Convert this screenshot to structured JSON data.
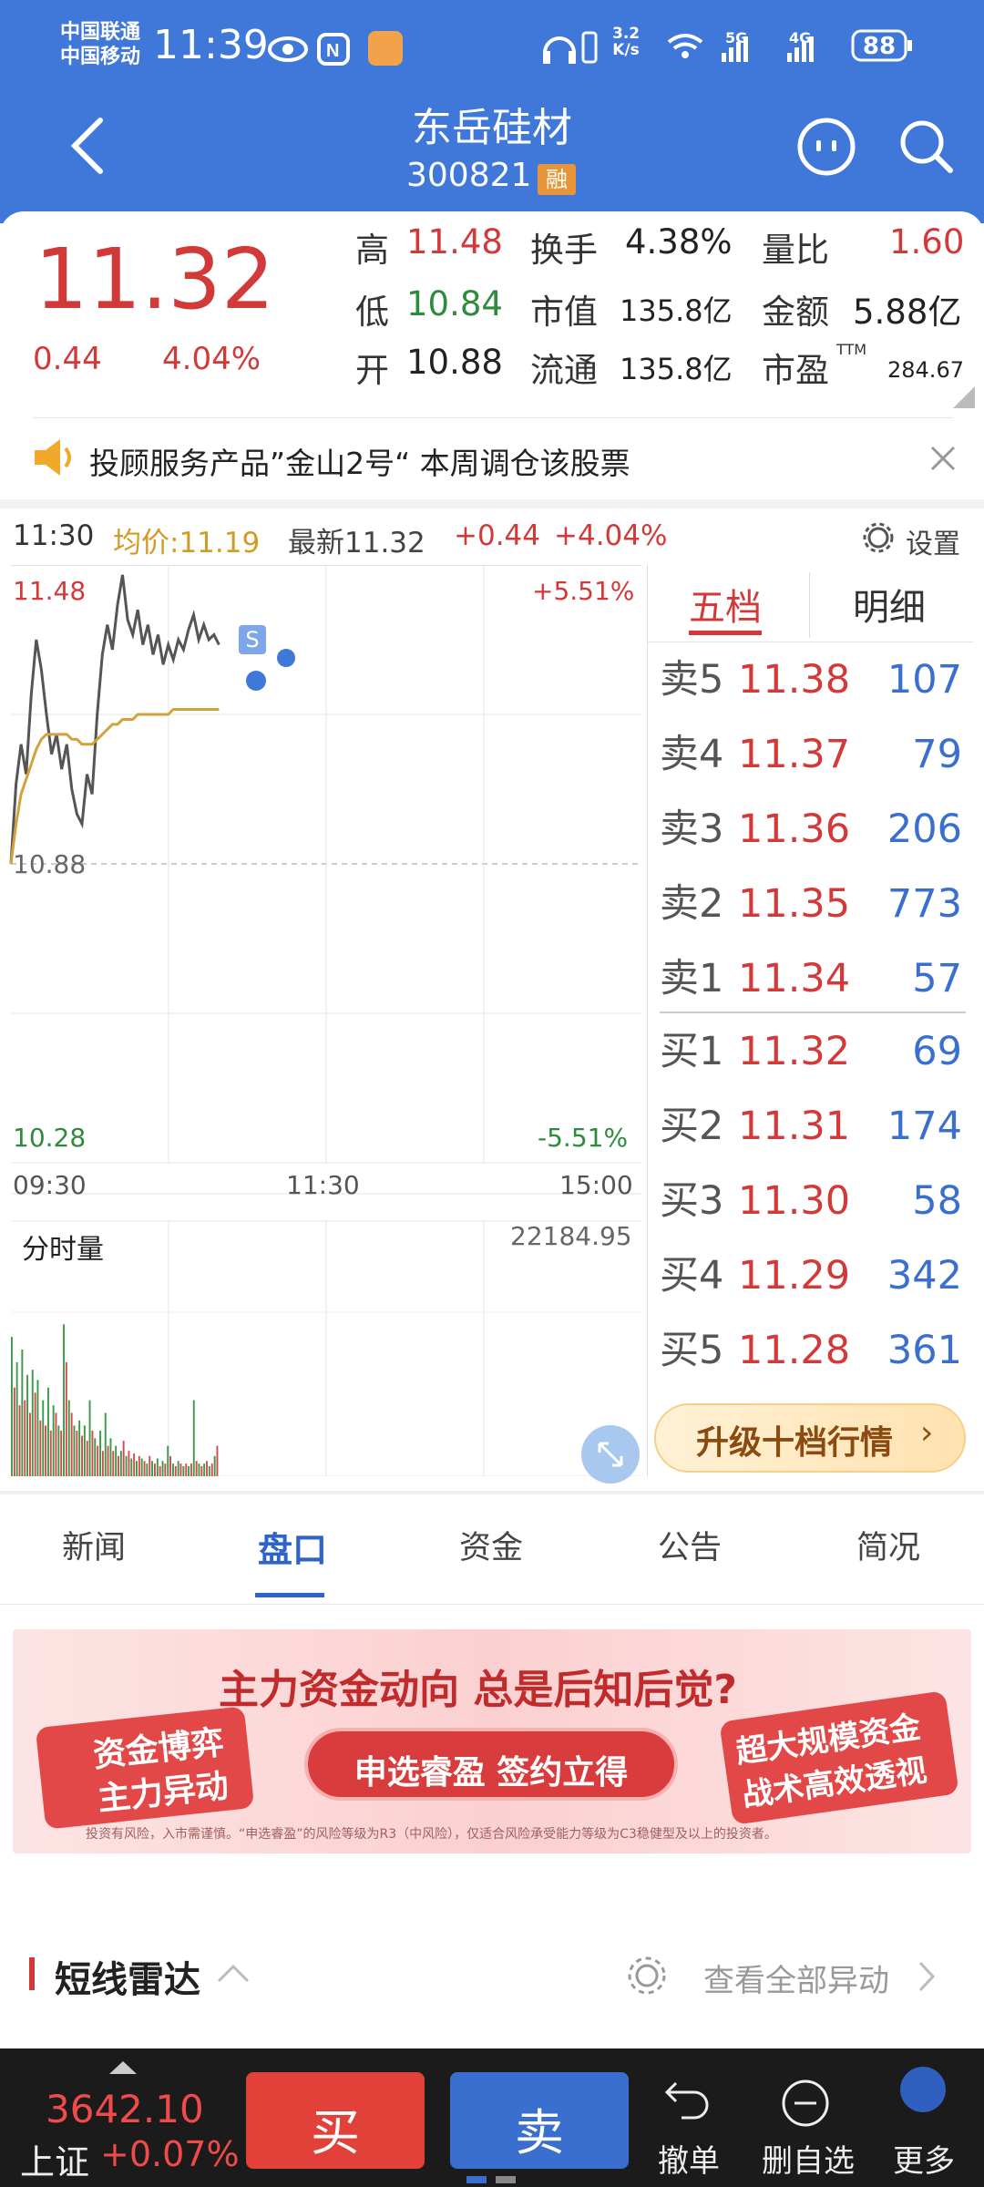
{
  "status_bar": {
    "carrier1": "中国联通",
    "carrier2": "中国移动",
    "time": "11:39",
    "net_speed_top": "3.2",
    "net_speed_bottom": "K/s",
    "battery": "88"
  },
  "header": {
    "name": "东岳硅材",
    "code": "300821",
    "badge": "融"
  },
  "quote": {
    "price": "11.32",
    "change": "0.44",
    "change_pct": "4.04%",
    "high_label": "高",
    "high": "11.48",
    "low_label": "低",
    "low": "10.84",
    "open_label": "开",
    "open": "10.88",
    "turnover_label": "换手",
    "turnover": "4.38%",
    "mcap_label": "市值",
    "mcap": "135.8亿",
    "float_label": "流通",
    "float": "135.8亿",
    "vol_ratio_label": "量比",
    "vol_ratio": "1.60",
    "amount_label": "金额",
    "amount": "5.88亿",
    "pe_label": "市盈",
    "pe_sup": "TTM",
    "pe": "284.67"
  },
  "notice": {
    "text": "投顾服务产品”金山2号“ 本周调仓该股票"
  },
  "chart_header": {
    "time": "11:30",
    "avg": "均价:11.19",
    "latest": "最新11.32",
    "chg": "+0.44",
    "chg_pct": "+4.04%",
    "settings": "设置"
  },
  "chart_labels": {
    "top_price": "11.48",
    "top_pct": "+5.51%",
    "mid_price": "10.88",
    "bot_price": "10.28",
    "bot_pct": "-5.51%",
    "t0": "09:30",
    "t1": "11:30",
    "t2": "15:00",
    "vol_title": "分时量",
    "vol_max": "22184.95",
    "marker": "S"
  },
  "chart_data": {
    "type": "line",
    "title": "",
    "ylim": [
      10.28,
      11.48
    ],
    "x_ticks": [
      "09:30",
      "11:30",
      "15:00"
    ],
    "series": [
      {
        "name": "",
        "values": [
          10.88,
          11.04,
          11.12,
          11.06,
          11.22,
          11.33,
          11.27,
          11.18,
          11.1,
          11.14,
          11.07,
          11.12,
          11.03,
          10.98,
          10.96,
          11.06,
          11.02,
          11.18,
          11.3,
          11.36,
          11.31,
          11.4,
          11.46,
          11.37,
          11.34,
          11.39,
          11.32,
          11.36,
          11.3,
          11.34,
          11.28,
          11.32,
          11.29,
          11.33,
          11.31,
          11.35,
          11.38,
          11.33,
          11.36,
          11.33,
          11.34,
          11.32
        ]
      },
      {
        "name": "",
        "values": [
          10.88,
          10.96,
          11.02,
          11.05,
          11.08,
          11.11,
          11.13,
          11.14,
          11.14,
          11.14,
          11.14,
          11.14,
          11.13,
          11.13,
          11.12,
          11.12,
          11.12,
          11.13,
          11.14,
          11.15,
          11.16,
          11.16,
          11.17,
          11.17,
          11.17,
          11.18,
          11.18,
          11.18,
          11.18,
          11.18,
          11.18,
          11.18,
          11.19,
          11.19,
          11.19,
          11.19,
          11.19,
          11.19,
          11.19,
          11.19,
          11.19,
          11.19
        ]
      }
    ],
    "volume_max": 22184.95,
    "volume": [
      0.55,
      0.35,
      0.45,
      0.28,
      0.5,
      0.3,
      0.4,
      0.25,
      0.42,
      0.33,
      0.38,
      0.22,
      0.3,
      0.2,
      0.35,
      0.18,
      0.28,
      0.25,
      0.2,
      0.18,
      0.6,
      0.45,
      0.3,
      0.25,
      0.2,
      0.18,
      0.22,
      0.16,
      0.2,
      0.14,
      0.3,
      0.18,
      0.15,
      0.12,
      0.18,
      0.1,
      0.25,
      0.12,
      0.15,
      0.1,
      0.12,
      0.08,
      0.1,
      0.14,
      0.08,
      0.1,
      0.07,
      0.09,
      0.06,
      0.08,
      0.07,
      0.06,
      0.05,
      0.08,
      0.06,
      0.05,
      0.07,
      0.04,
      0.06,
      0.05,
      0.12,
      0.08,
      0.05,
      0.04,
      0.06,
      0.05,
      0.04,
      0.05,
      0.04,
      0.05,
      0.3,
      0.06,
      0.05,
      0.04,
      0.05,
      0.06,
      0.04,
      0.05,
      0.08,
      0.12
    ]
  },
  "order_book": {
    "tab_active": "五档",
    "tab_other": "明细",
    "asks": [
      {
        "label": "卖5",
        "price": "11.38",
        "vol": "107"
      },
      {
        "label": "卖4",
        "price": "11.37",
        "vol": "79"
      },
      {
        "label": "卖3",
        "price": "11.36",
        "vol": "206"
      },
      {
        "label": "卖2",
        "price": "11.35",
        "vol": "773"
      },
      {
        "label": "卖1",
        "price": "11.34",
        "vol": "57"
      }
    ],
    "bids": [
      {
        "label": "买1",
        "price": "11.32",
        "vol": "69"
      },
      {
        "label": "买2",
        "price": "11.31",
        "vol": "174"
      },
      {
        "label": "买3",
        "price": "11.30",
        "vol": "58"
      },
      {
        "label": "买4",
        "price": "11.29",
        "vol": "342"
      },
      {
        "label": "买5",
        "price": "11.28",
        "vol": "361"
      }
    ],
    "upgrade": "升级十档行情"
  },
  "tabs": [
    "新闻",
    "盘口",
    "资金",
    "公告",
    "简况"
  ],
  "banner": {
    "headline": "主力资金动向 总是后知后觉?",
    "left1": "资金博弈",
    "left2": "主力异动",
    "cta": "申选睿盈 签约立得",
    "right1": "超大规模资金",
    "right2": "战术高效透视",
    "disclaimer": "投资有风险，入市需谨慎。“申选睿盈”的风险等级为R3（中风险），仅适合风险承受能力等级为C3稳健型及以上的投资者。"
  },
  "radar": {
    "title": "短线雷达",
    "link": "查看全部异动"
  },
  "bottom": {
    "index_value": "3642.10",
    "index_name": "上证",
    "index_chg": "+0.07%",
    "buy": "买",
    "sell": "卖",
    "cancel": "撤单",
    "remove": "删自选",
    "more": "更多"
  }
}
